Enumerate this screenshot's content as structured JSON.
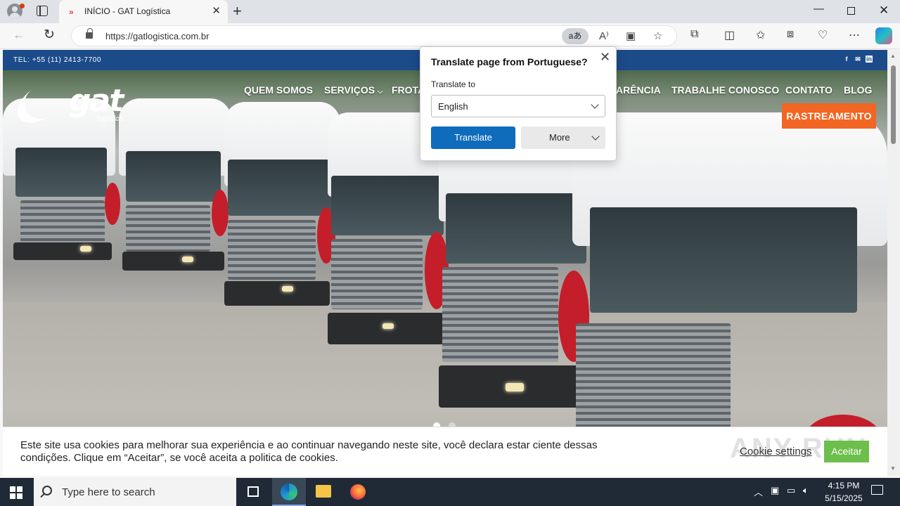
{
  "browser": {
    "tab_title": "INÍCIO - GAT Logística",
    "tab_favicon": "»",
    "url": "https://gatlogistica.com.br",
    "translate_icon_label": "aあ"
  },
  "site": {
    "phone": "TEL: +55 (11) 2413-7700",
    "social_icons": [
      "facebook-icon",
      "email-icon",
      "linkedin-icon"
    ],
    "logo_text": "gat",
    "logo_sub": "logística",
    "nav": {
      "quem_somos": "QUEM SOMOS",
      "servicos": "SERVIÇOS",
      "frota": "FROTA",
      "transparencia": "ARÊNCIA",
      "trabalhe": "TRABALHE CONOSCO",
      "contato": "CONTATO",
      "blog": "BLOG"
    },
    "cta": "RASTREAMENTO",
    "slider": {
      "total": 2,
      "active": 1
    },
    "colors": {
      "topbar": "#1c4b8a",
      "cta": "#f26522",
      "accept": "#6cbf4a"
    }
  },
  "cookie": {
    "text": "Este site usa cookies para melhorar sua experiência e ao continuar navegando neste site, você declara estar ciente dessas condições. Clique em “Aceitar”, se você aceita a politica de cookies.",
    "settings_label": "Cookie settings",
    "accept_label": "Aceitar",
    "watermark": "ANY RUN"
  },
  "translate_popup": {
    "title": "Translate page from Portuguese?",
    "label": "Translate to",
    "language": "English",
    "translate_label": "Translate",
    "more_label": "More"
  },
  "taskbar": {
    "search_placeholder": "Type here to search",
    "time": "4:15 PM",
    "date": "5/15/2025"
  }
}
